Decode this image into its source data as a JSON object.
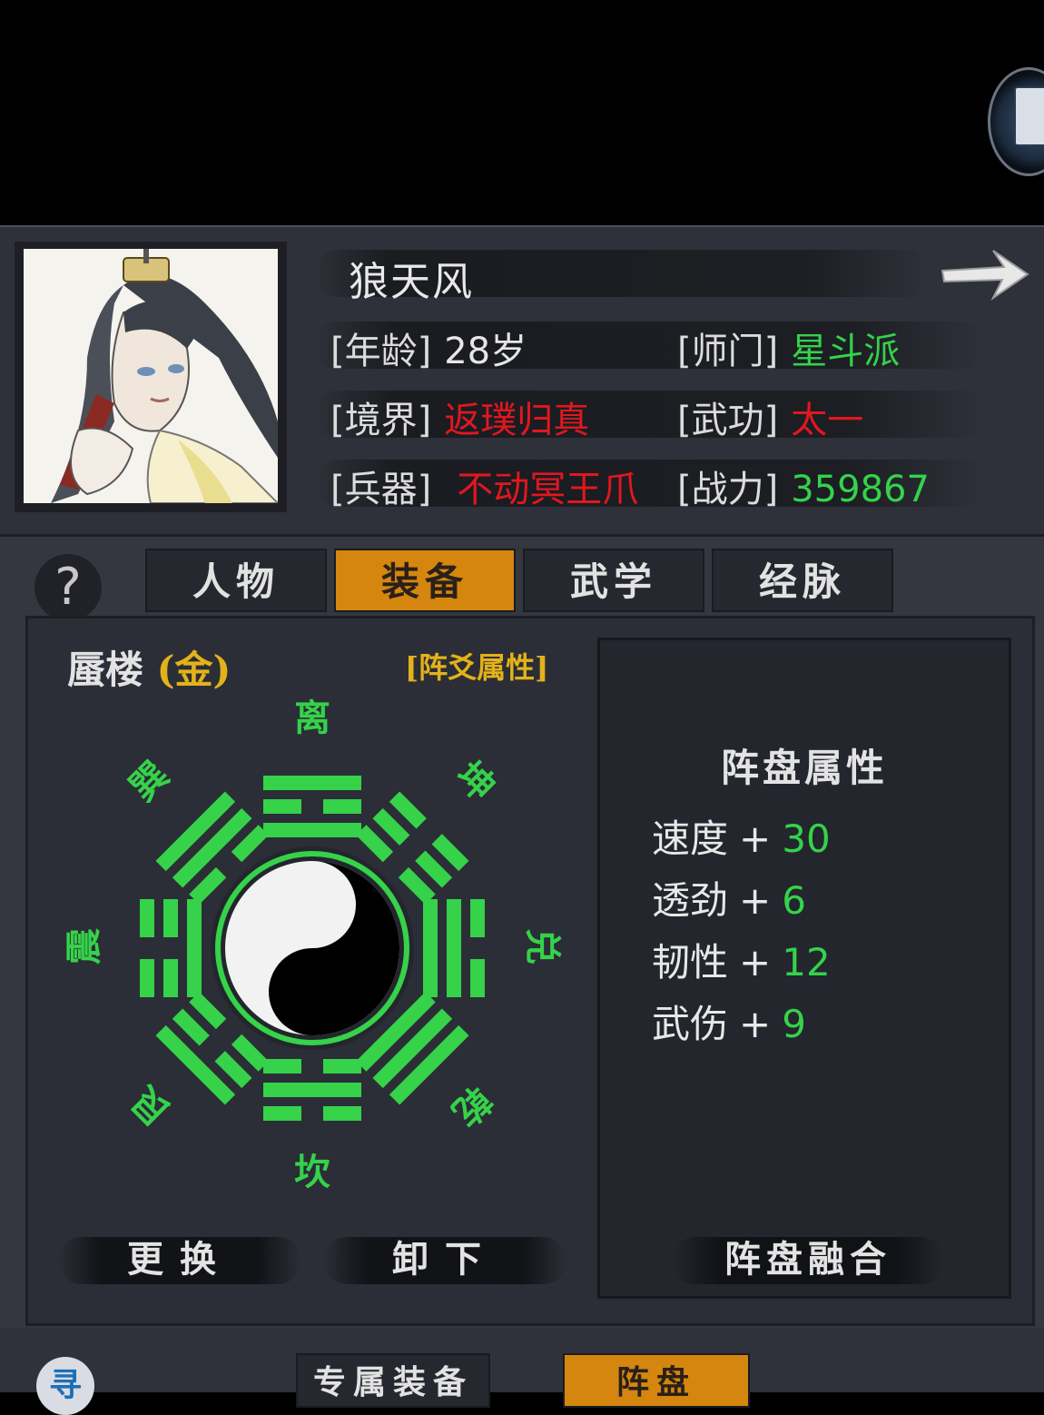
{
  "character": {
    "name": "狼天风",
    "stats": [
      {
        "label": "[年龄]",
        "value": "28岁",
        "color": "white"
      },
      {
        "label": "[师门]",
        "value": "星斗派",
        "color": "green"
      },
      {
        "label": "[境界]",
        "value": "返璞归真",
        "color": "red"
      },
      {
        "label": "[武功]",
        "value": "太一",
        "color": "red"
      },
      {
        "label": "[兵器]",
        "value": "不动冥王爪",
        "color": "red"
      },
      {
        "label": "[战力]",
        "value": "359867",
        "color": "green"
      }
    ]
  },
  "help_label": "?",
  "tabs": [
    {
      "label": "人物",
      "active": false
    },
    {
      "label": "装备",
      "active": true
    },
    {
      "label": "武学",
      "active": false
    },
    {
      "label": "经脉",
      "active": false
    }
  ],
  "formation": {
    "name": "蜃楼",
    "element": "(金)",
    "yao_link": "[阵爻属性]",
    "trigrams": {
      "li": "离",
      "kun": "坤",
      "dui": "兑",
      "qian": "乾",
      "kan": "坎",
      "gen": "艮",
      "zhen": "震",
      "xun": "巽"
    },
    "trigram_color": "#35d24a"
  },
  "actions": {
    "replace": "更换",
    "unequip": "卸下",
    "fuse": "阵盘融合"
  },
  "attributes": {
    "title": "阵盘属性",
    "rows": [
      {
        "name": "速度",
        "value": "30"
      },
      {
        "name": "透劲",
        "value": "6"
      },
      {
        "name": "韧性",
        "value": "12"
      },
      {
        "name": "武伤",
        "value": "9"
      }
    ]
  },
  "bottom": {
    "search_icon_char": "寻",
    "tabs": [
      {
        "label": "专属装备",
        "active": false
      },
      {
        "label": "阵盘",
        "active": true
      }
    ]
  }
}
